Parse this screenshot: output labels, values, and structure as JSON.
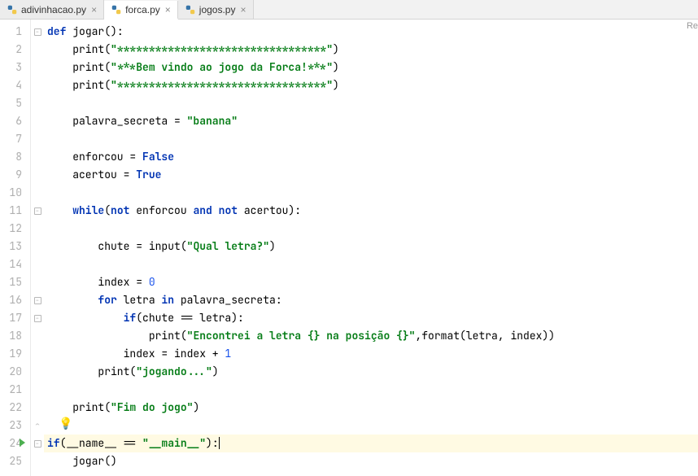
{
  "tabs": [
    {
      "label": "adivinhacao.py",
      "active": false
    },
    {
      "label": "forca.py",
      "active": true
    },
    {
      "label": "jogos.py",
      "active": false
    }
  ],
  "right_clip": "Re",
  "gutter": {
    "start": 1,
    "end": 25,
    "breakpoint_line": 24,
    "bulb_line": 23
  },
  "code": {
    "highlighted_line": 24,
    "lines": [
      {
        "n": 1,
        "indent": 0,
        "tokens": [
          [
            "kw",
            "def"
          ],
          [
            "pun",
            " "
          ],
          [
            "fn",
            "jogar"
          ],
          [
            "pun",
            "():"
          ]
        ],
        "fold": "minus"
      },
      {
        "n": 2,
        "indent": 1,
        "tokens": [
          [
            "builtin",
            "print"
          ],
          [
            "pun",
            "("
          ],
          [
            "str",
            "\"*********************************\""
          ],
          [
            "pun",
            ")"
          ]
        ]
      },
      {
        "n": 3,
        "indent": 1,
        "tokens": [
          [
            "builtin",
            "print"
          ],
          [
            "pun",
            "("
          ],
          [
            "str",
            "\"***Bem vindo ao jogo da Forca!***\""
          ],
          [
            "pun",
            ")"
          ]
        ]
      },
      {
        "n": 4,
        "indent": 1,
        "tokens": [
          [
            "builtin",
            "print"
          ],
          [
            "pun",
            "("
          ],
          [
            "str",
            "\"*********************************\""
          ],
          [
            "pun",
            ")"
          ]
        ]
      },
      {
        "n": 5,
        "indent": 0,
        "tokens": []
      },
      {
        "n": 6,
        "indent": 1,
        "tokens": [
          [
            "id",
            "palavra_secreta = "
          ],
          [
            "str",
            "\"banana\""
          ]
        ]
      },
      {
        "n": 7,
        "indent": 0,
        "tokens": []
      },
      {
        "n": 8,
        "indent": 1,
        "tokens": [
          [
            "id",
            "enforcou = "
          ],
          [
            "boolv",
            "False"
          ]
        ]
      },
      {
        "n": 9,
        "indent": 1,
        "tokens": [
          [
            "id",
            "acertou = "
          ],
          [
            "boolv",
            "True"
          ]
        ]
      },
      {
        "n": 10,
        "indent": 0,
        "tokens": []
      },
      {
        "n": 11,
        "indent": 1,
        "tokens": [
          [
            "kw",
            "while"
          ],
          [
            "pun",
            "("
          ],
          [
            "kw",
            "not"
          ],
          [
            "id",
            " enforcou "
          ],
          [
            "kw",
            "and"
          ],
          [
            "id",
            " "
          ],
          [
            "kw",
            "not"
          ],
          [
            "id",
            " acertou):"
          ]
        ],
        "fold": "minus"
      },
      {
        "n": 12,
        "indent": 0,
        "tokens": []
      },
      {
        "n": 13,
        "indent": 2,
        "tokens": [
          [
            "id",
            "chute = "
          ],
          [
            "builtin",
            "input"
          ],
          [
            "pun",
            "("
          ],
          [
            "str",
            "\"Qual letra?\""
          ],
          [
            "pun",
            ")"
          ]
        ]
      },
      {
        "n": 14,
        "indent": 0,
        "tokens": []
      },
      {
        "n": 15,
        "indent": 2,
        "tokens": [
          [
            "id",
            "index = "
          ],
          [
            "num",
            "0"
          ]
        ]
      },
      {
        "n": 16,
        "indent": 2,
        "tokens": [
          [
            "kw",
            "for"
          ],
          [
            "id",
            " letra "
          ],
          [
            "kw",
            "in"
          ],
          [
            "id",
            " palavra_secreta:"
          ]
        ],
        "fold": "minus"
      },
      {
        "n": 17,
        "indent": 3,
        "tokens": [
          [
            "kw",
            "if"
          ],
          [
            "pun",
            "(chute == letra):"
          ]
        ],
        "fold": "minus"
      },
      {
        "n": 18,
        "indent": 4,
        "tokens": [
          [
            "builtin",
            "print"
          ],
          [
            "pun",
            "("
          ],
          [
            "str",
            "\"Encontrei a letra {} na posição {}\""
          ],
          [
            "pun",
            ",format(letra, index))"
          ]
        ]
      },
      {
        "n": 19,
        "indent": 3,
        "tokens": [
          [
            "id",
            "index = index + "
          ],
          [
            "num",
            "1"
          ]
        ]
      },
      {
        "n": 20,
        "indent": 2,
        "tokens": [
          [
            "builtin",
            "print"
          ],
          [
            "pun",
            "("
          ],
          [
            "str",
            "\"jogando...\""
          ],
          [
            "pun",
            ")"
          ]
        ]
      },
      {
        "n": 21,
        "indent": 0,
        "tokens": []
      },
      {
        "n": 22,
        "indent": 1,
        "tokens": [
          [
            "builtin",
            "print"
          ],
          [
            "pun",
            "("
          ],
          [
            "str",
            "\"Fim do jogo\""
          ],
          [
            "pun",
            ")"
          ]
        ]
      },
      {
        "n": 23,
        "indent": 0,
        "tokens": [],
        "fold": "up"
      },
      {
        "n": 24,
        "indent": 0,
        "tokens": [
          [
            "kw",
            "if"
          ],
          [
            "pun",
            "(__name__ == "
          ],
          [
            "str",
            "\"__main__\""
          ],
          [
            "pun",
            "):"
          ]
        ],
        "cursor_after": true,
        "fold": "minus"
      },
      {
        "n": 25,
        "indent": 1,
        "tokens": [
          [
            "id",
            "jogar()"
          ]
        ]
      }
    ]
  }
}
